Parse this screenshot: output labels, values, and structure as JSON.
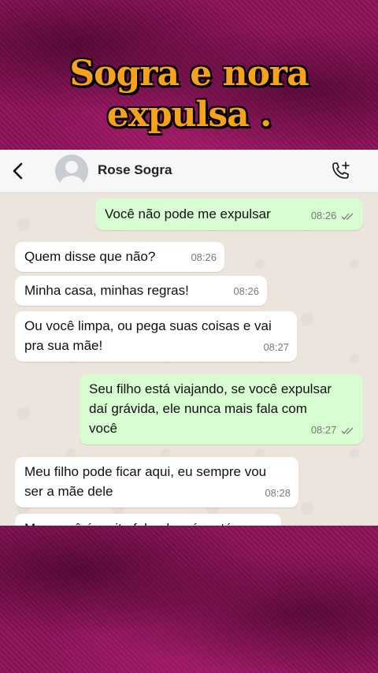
{
  "overlay": {
    "title_line1": "Sogra e nora",
    "title_line2": "expulsa ."
  },
  "header": {
    "contact_name": "Rose Sogra"
  },
  "messages": [
    {
      "dir": "out",
      "text": "Você não pode me expulsar",
      "time": "08:26",
      "read": true
    },
    {
      "dir": "in",
      "text": "Quem disse que não?",
      "time": "08:26"
    },
    {
      "dir": "in",
      "text": "Minha casa, minhas regras!",
      "time": "08:26"
    },
    {
      "dir": "in",
      "text": "Ou você limpa, ou pega suas coisas e vai pra sua mãe!",
      "time": "08:27"
    },
    {
      "dir": "out",
      "text": "Seu filho está viajando, se você expulsar daí grávida, ele nunca mais fala com você",
      "time": "08:27",
      "read": true
    },
    {
      "dir": "in",
      "text": "Meu filho pode ficar aqui, eu sempre vou ser a mãe dele",
      "time": "08:28"
    },
    {
      "dir": "in",
      "text": "Mas você é muito folgada, só na tá",
      "time": ""
    }
  ]
}
